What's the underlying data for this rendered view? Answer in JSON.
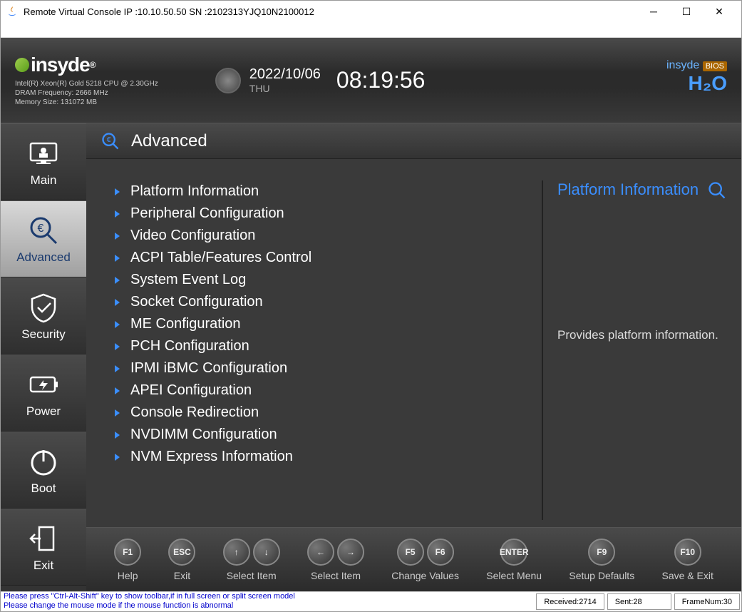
{
  "window": {
    "title": "Remote Virtual Console   IP :10.10.50.50   SN :2102313YJQ10N2100012"
  },
  "header": {
    "brand": "insyde",
    "cpu": "Intel(R) Xeon(R) Gold 5218 CPU @ 2.30GHz",
    "dram": "DRAM Frequency: 2666 MHz",
    "memory": "Memory Size: 131072 MB",
    "date": "2022/10/06",
    "day": "THU",
    "time": "08:19:56",
    "brand_right": "insyde",
    "brand_bios": "BIOS",
    "brand_h2": "H₂O"
  },
  "sidebar": [
    {
      "label": "Main",
      "name": "sidebar-main",
      "active": false
    },
    {
      "label": "Advanced",
      "name": "sidebar-advanced",
      "active": true
    },
    {
      "label": "Security",
      "name": "sidebar-security",
      "active": false
    },
    {
      "label": "Power",
      "name": "sidebar-power",
      "active": false
    },
    {
      "label": "Boot",
      "name": "sidebar-boot",
      "active": false
    },
    {
      "label": "Exit",
      "name": "sidebar-exit",
      "active": false
    }
  ],
  "panel": {
    "title": "Advanced",
    "items": [
      "Platform Information",
      "Peripheral Configuration",
      "Video Configuration",
      "ACPI Table/Features Control",
      "System Event Log",
      "Socket Configuration",
      "ME Configuration",
      "PCH Configuration",
      "IPMI iBMC Configuration",
      "APEI Configuration",
      "Console Redirection",
      "NVDIMM Configuration",
      "NVM Express Information"
    ]
  },
  "help": {
    "title": "Platform Information",
    "desc": "Provides platform information."
  },
  "footer": [
    {
      "keys": [
        "F1"
      ],
      "label": "Help",
      "name": "footer-help"
    },
    {
      "keys": [
        "ESC"
      ],
      "label": "Exit",
      "name": "footer-exit"
    },
    {
      "keys": [
        "↑",
        "↓"
      ],
      "label": "Select Item",
      "name": "footer-select-item-ud"
    },
    {
      "keys": [
        "←",
        "→"
      ],
      "label": "Select Item",
      "name": "footer-select-item-lr"
    },
    {
      "keys": [
        "F5",
        "F6"
      ],
      "label": "Change Values",
      "name": "footer-change-values"
    },
    {
      "keys": [
        "ENTER"
      ],
      "label": "Select Menu",
      "name": "footer-select-menu"
    },
    {
      "keys": [
        "F9"
      ],
      "label": "Setup Defaults",
      "name": "footer-setup-defaults"
    },
    {
      "keys": [
        "F10"
      ],
      "label": "Save & Exit",
      "name": "footer-save-exit"
    }
  ],
  "status": {
    "hint1": "Please press \"Ctrl-Alt-Shift\" key to show toolbar,if in full screen or split screen model",
    "hint2": "Please change the mouse mode if the mouse function is abnormal",
    "received": "Received:2714",
    "sent": "Sent:28",
    "frame": "FrameNum:30"
  }
}
